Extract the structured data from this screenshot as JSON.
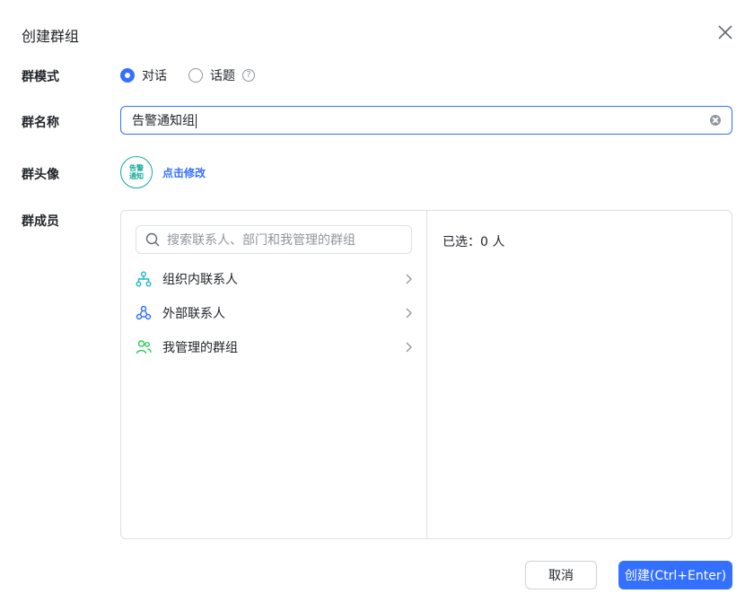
{
  "dialog": {
    "title": "创建群组"
  },
  "mode": {
    "label": "群模式",
    "options": [
      {
        "label": "对话",
        "checked": true
      },
      {
        "label": "话题",
        "checked": false
      }
    ],
    "help_glyph": "?"
  },
  "name": {
    "label": "群名称",
    "value": "告警通知组"
  },
  "avatar": {
    "label": "群头像",
    "line1": "告警",
    "line2": "通知",
    "edit_label": "点击修改",
    "color": "#14a99a"
  },
  "members": {
    "label": "群成员",
    "search_placeholder": "搜索联系人、部门和我管理的群组",
    "sources": [
      {
        "label": "组织内联系人",
        "icon": "org-tree-icon"
      },
      {
        "label": "外部联系人",
        "icon": "external-contacts-icon"
      },
      {
        "label": "我管理的群组",
        "icon": "managed-groups-icon"
      }
    ],
    "selected_text": "已选：0 人"
  },
  "footer": {
    "cancel_label": "取消",
    "create_label": "创建(Ctrl+Enter)"
  },
  "colors": {
    "accent": "#3370ff",
    "border": "#dee0e3",
    "text": "#1f2329",
    "muted": "#8f959e"
  }
}
